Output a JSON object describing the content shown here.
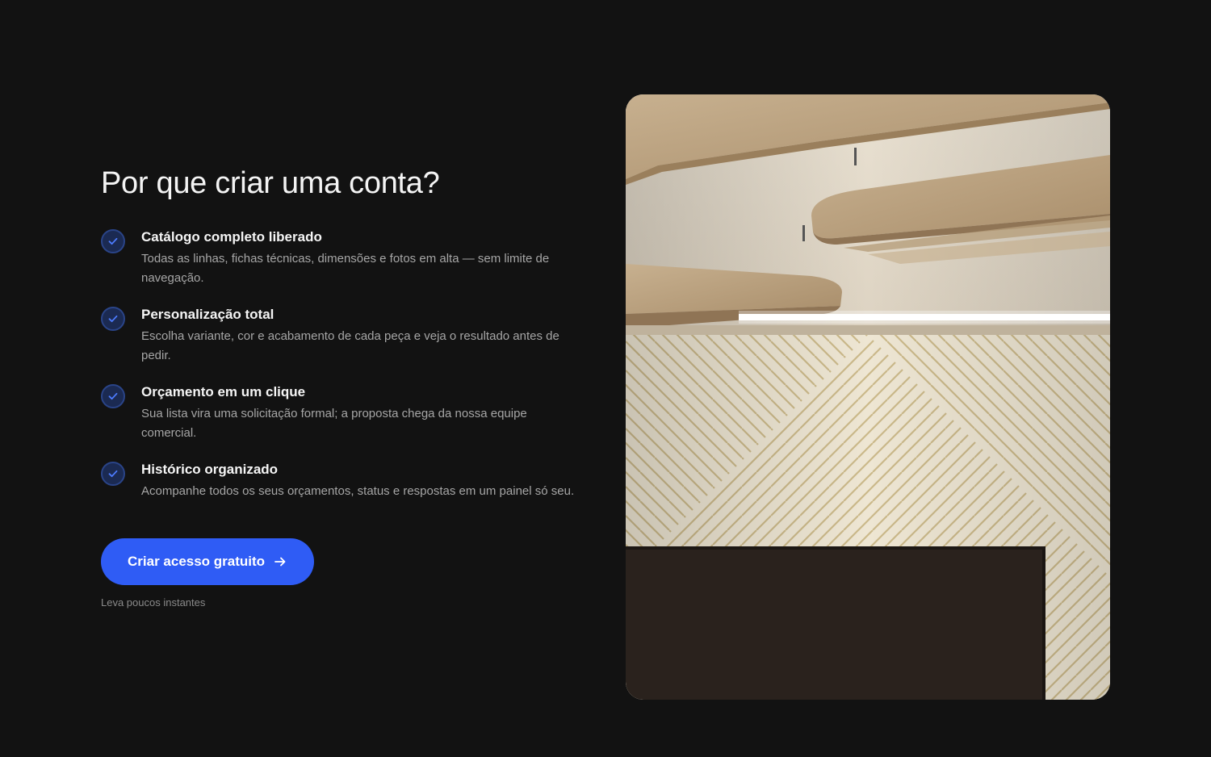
{
  "section": {
    "title": "Por que criar uma conta?"
  },
  "features": [
    {
      "title": "Catálogo completo liberado",
      "description": "Todas as linhas, fichas técnicas, dimensões e fotos em alta — sem limite de navegação.",
      "icon": "check-icon"
    },
    {
      "title": "Personalização total",
      "description": "Escolha variante, cor e acabamento de cada peça e veja o resultado antes de pedir.",
      "icon": "check-icon"
    },
    {
      "title": "Orçamento em um clique",
      "description": "Sua lista vira uma solicitação formal; a proposta chega da nossa equipe comercial.",
      "icon": "check-icon"
    },
    {
      "title": "Histórico organizado",
      "description": "Acompanhe todos os seus orçamentos, status e respostas em um painel só seu.",
      "icon": "check-icon"
    }
  ],
  "cta": {
    "label": "Criar acesso gratuito",
    "icon": "arrow-right-icon",
    "hint": "Leva poucos instantes"
  },
  "colors": {
    "background": "#121212",
    "accent": "#2f5cf5",
    "check_bg": "#1b2a52",
    "text_primary": "#f5f5f5",
    "text_secondary": "#a6a6a6"
  }
}
